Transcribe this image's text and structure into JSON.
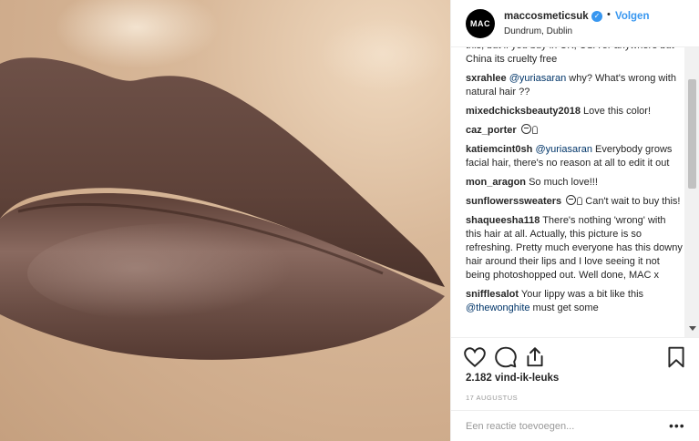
{
  "post": {
    "avatar_text": "MAC",
    "username": "maccosmeticsuk",
    "verified_mark": "✓",
    "separator": "•",
    "follow_label": "Volgen",
    "location": "Dundrum, Dublin"
  },
  "comments": [
    {
      "user": "",
      "mention": "",
      "text": "this, but if you buy in UK, USA or anywhere but China its cruelty free",
      "emoji": ""
    },
    {
      "user": "sxrahlee",
      "mention": "@yuriasaran",
      "text": " why? What's wrong with natural hair ??",
      "emoji": ""
    },
    {
      "user": "mixedchicksbeauty2018",
      "mention": "",
      "text": " Love this color!",
      "emoji": ""
    },
    {
      "user": "caz_porter",
      "mention": "",
      "text": " ",
      "emoji": "emoji-face-icon"
    },
    {
      "user": "katiemcint0sh",
      "mention": "@yuriasaran",
      "text": " Everybody grows facial hair, there's no reason at all to edit it out",
      "emoji": ""
    },
    {
      "user": "mon_aragon",
      "mention": "",
      "text": " So much love!!!",
      "emoji": ""
    },
    {
      "user": "sunflowerssweaters",
      "mention": "",
      "text": " Can't wait to buy this!",
      "emoji": "emoji-face-icon"
    },
    {
      "user": "shaqueesha118",
      "mention": "",
      "text": " There's nothing 'wrong' with this hair at all. Actually, this picture is so refreshing. Pretty much everyone has this downy hair around their lips and I love seeing it not being photoshopped out. Well done, MAC x",
      "emoji": ""
    },
    {
      "user": "snifflesalot",
      "mention": "",
      "text": " Your lippy was a bit like this",
      "emoji": ""
    },
    {
      "user": "",
      "mention": "@thewonghite",
      "text": " must get some",
      "emoji": ""
    }
  ],
  "footer": {
    "likes": "2.182 vind-ik-leuks",
    "date": "17 AUGUSTUS",
    "reply_placeholder": "Een reactie toevoegen...",
    "more_label": "•••"
  },
  "icons": {
    "like": "heart-icon",
    "comment": "comment-icon",
    "share": "share-icon",
    "save": "bookmark-icon"
  }
}
